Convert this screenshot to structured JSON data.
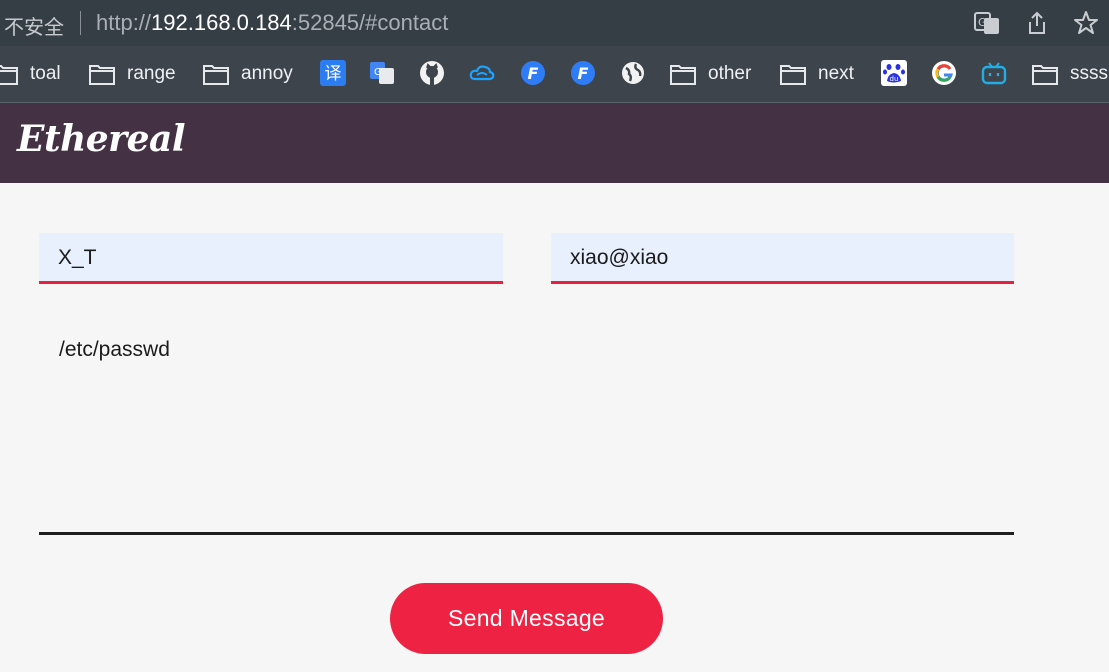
{
  "browser": {
    "security_label": "不安全",
    "url_scheme": "http://",
    "url_host": "192.168.0.184",
    "url_rest": ":52845/#contact",
    "bookmarks": [
      {
        "label": "toal",
        "icon": "folder-icon"
      },
      {
        "label": "range",
        "icon": "folder-icon"
      },
      {
        "label": "annoy",
        "icon": "folder-icon"
      },
      {
        "label": "",
        "icon": "translate-icon"
      },
      {
        "label": "",
        "icon": "google-translate-icon"
      },
      {
        "label": "",
        "icon": "github-icon"
      },
      {
        "label": "",
        "icon": "cloud-icon"
      },
      {
        "label": "",
        "icon": "fofa-icon"
      },
      {
        "label": "",
        "icon": "fofa-icon"
      },
      {
        "label": "",
        "icon": "globe-icon"
      },
      {
        "label": "other",
        "icon": "folder-icon"
      },
      {
        "label": "next",
        "icon": "folder-icon"
      },
      {
        "label": "",
        "icon": "baidu-icon"
      },
      {
        "label": "",
        "icon": "google-icon"
      },
      {
        "label": "",
        "icon": "bilibili-icon"
      },
      {
        "label": "ssss",
        "icon": "folder-icon"
      }
    ],
    "translate_glyph": "译",
    "fofa_glyph": "F"
  },
  "site": {
    "logo": "Ethereal"
  },
  "form": {
    "name_value": "X_T",
    "email_value": "xiao@xiao",
    "message_value": "/etc/passwd",
    "submit_label": "Send Message"
  },
  "colors": {
    "header": "#443144",
    "accent": "#ee2343",
    "field_bg": "#e8f0fe"
  }
}
